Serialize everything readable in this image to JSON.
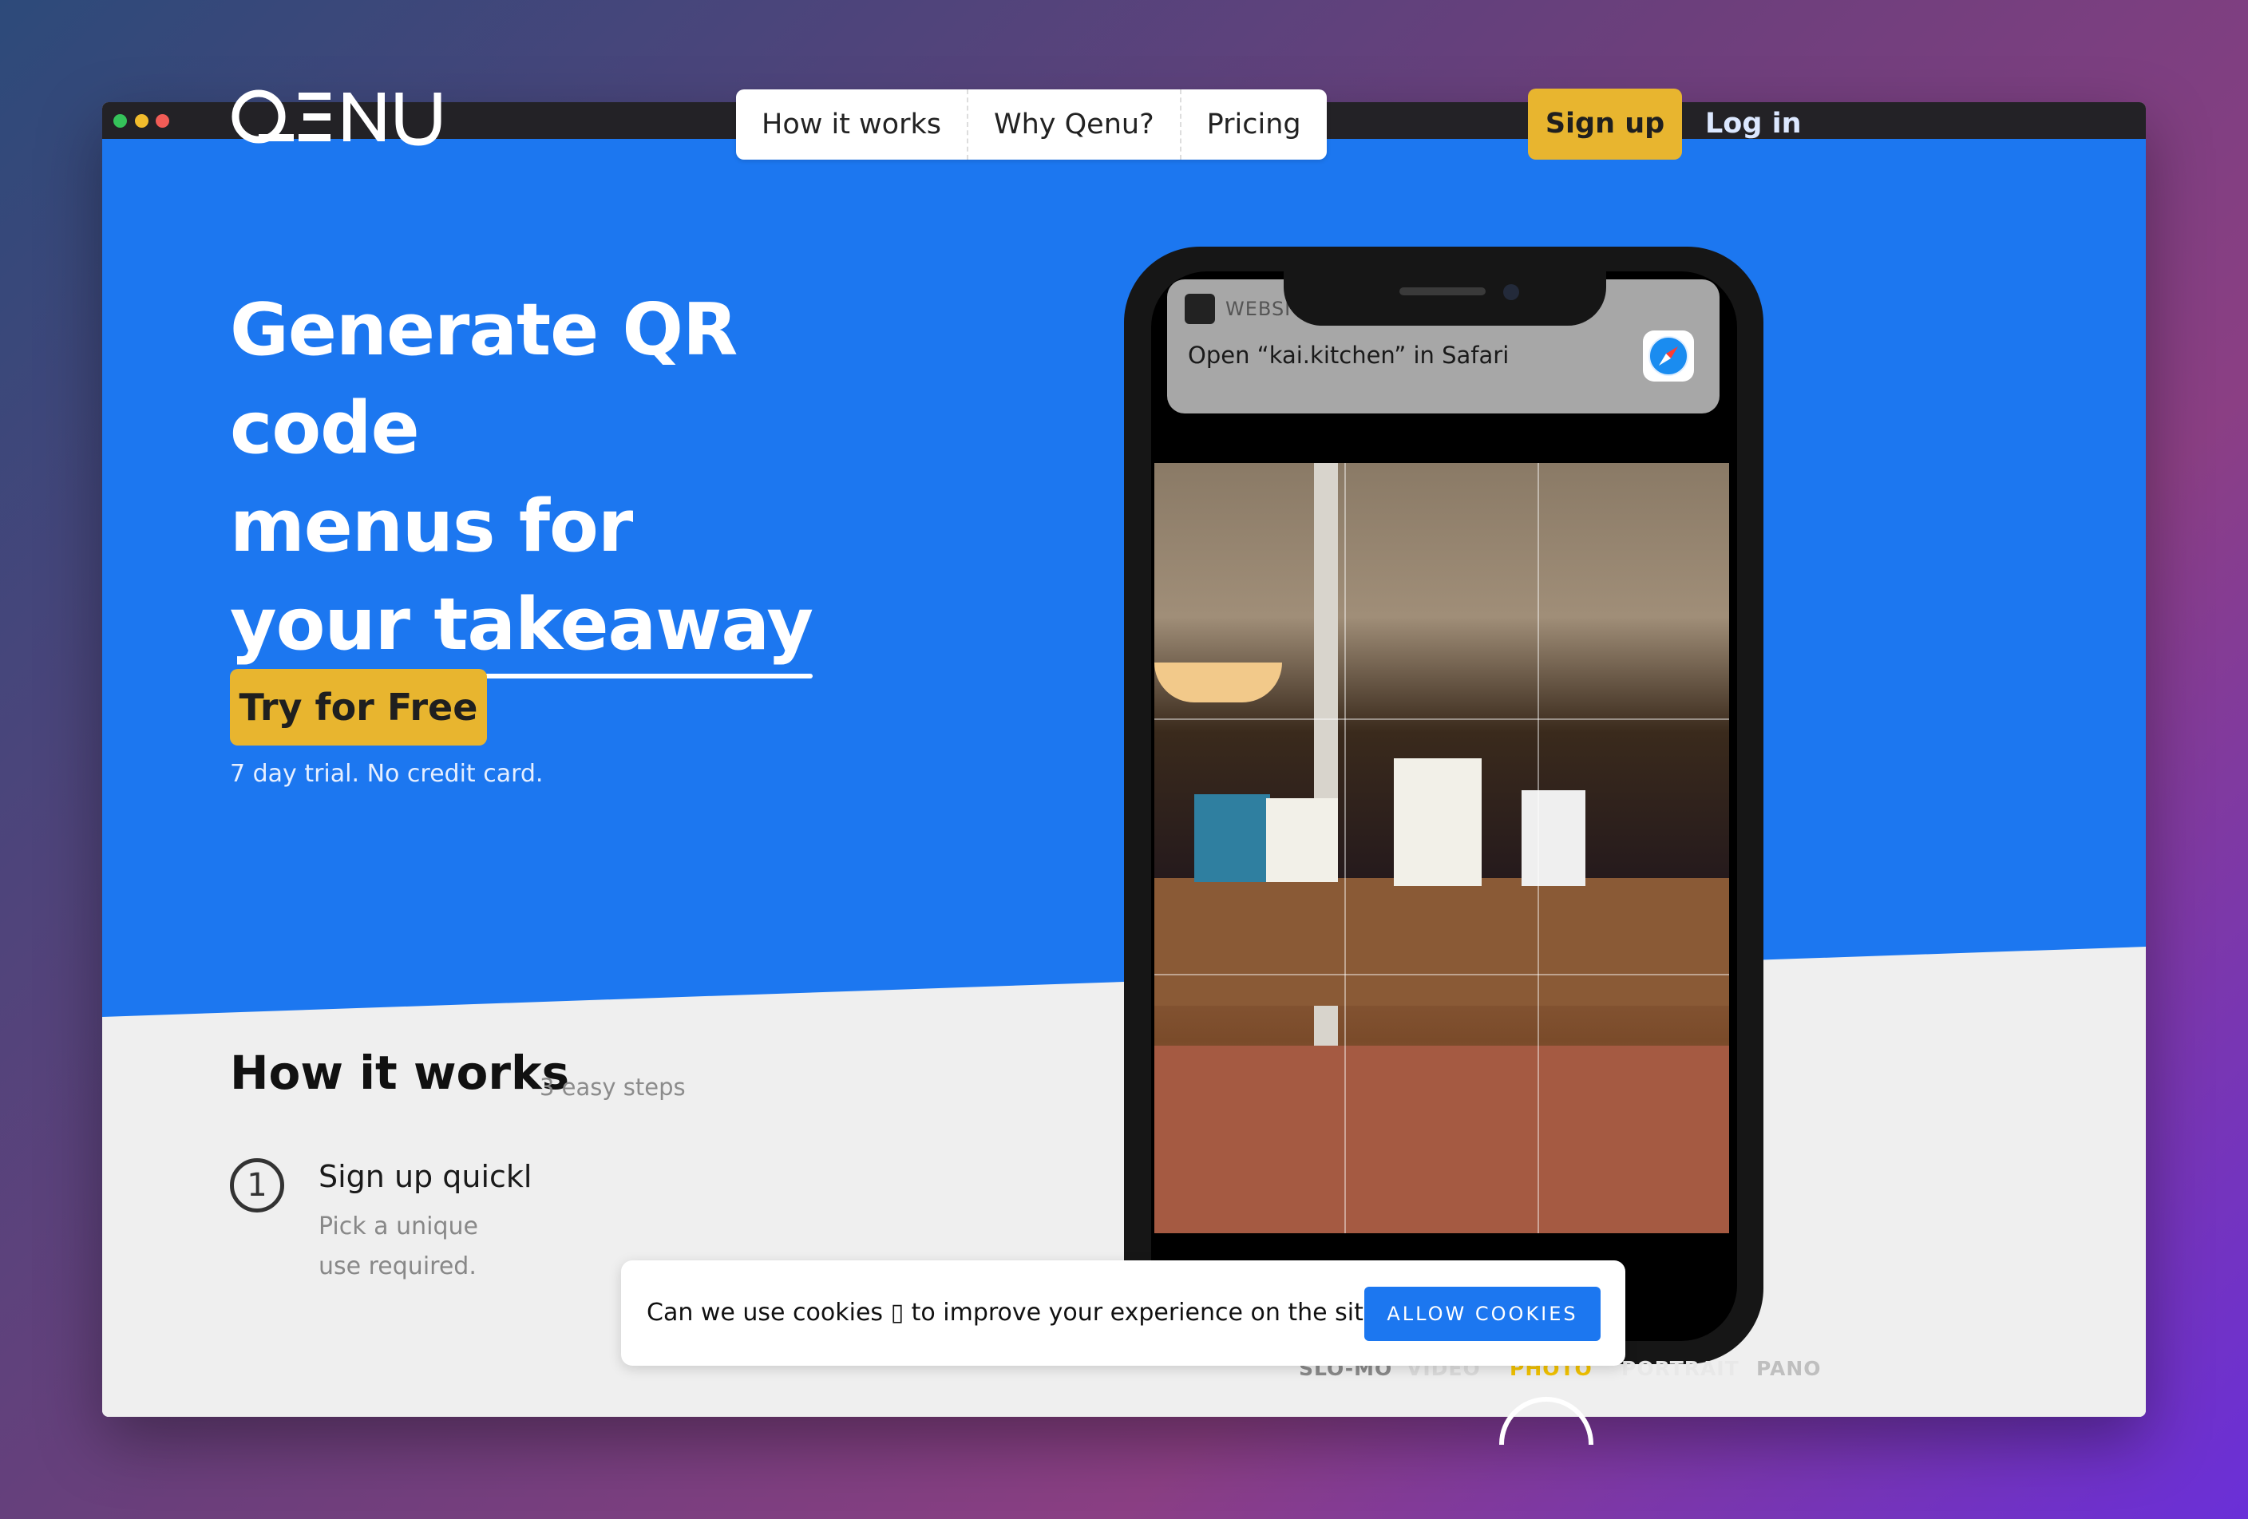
{
  "window_controls": [
    "close",
    "minimize",
    "zoom"
  ],
  "brand": {
    "logo_text": "QENU"
  },
  "nav": {
    "items": [
      "How it works",
      "Why Qenu?",
      "Pricing"
    ]
  },
  "auth": {
    "signup_label": "Sign up",
    "login_label": "Log in"
  },
  "hero": {
    "line1": "Generate QR code",
    "line2": "menus for",
    "line3a": "your",
    "line3b": "takeaway",
    "cta_label": "Try for Free",
    "cta_note": "7 day trial. No credit card."
  },
  "how": {
    "title": "How it works",
    "subtitle": "3 easy steps",
    "steps": [
      {
        "number": "1",
        "title": "Sign up quickl",
        "description": "Pick a unique use required."
      }
    ]
  },
  "phone": {
    "notification_app": "WEBSIT",
    "notification_text": "Open “kai.kitchen” in Safari",
    "camera_modes": [
      "SLO-MO",
      "VIDEO",
      "PHOTO",
      "PORTRAIT",
      "PANO"
    ],
    "active_mode": "PHOTO"
  },
  "cookie": {
    "text": "Can we use cookies ▯ to improve your experience on the site?",
    "button_label": "ALLOW COOKIES"
  },
  "colors": {
    "primary_blue": "#1c77f0",
    "accent_yellow": "#e8b52f",
    "light_bg": "#efefef"
  }
}
